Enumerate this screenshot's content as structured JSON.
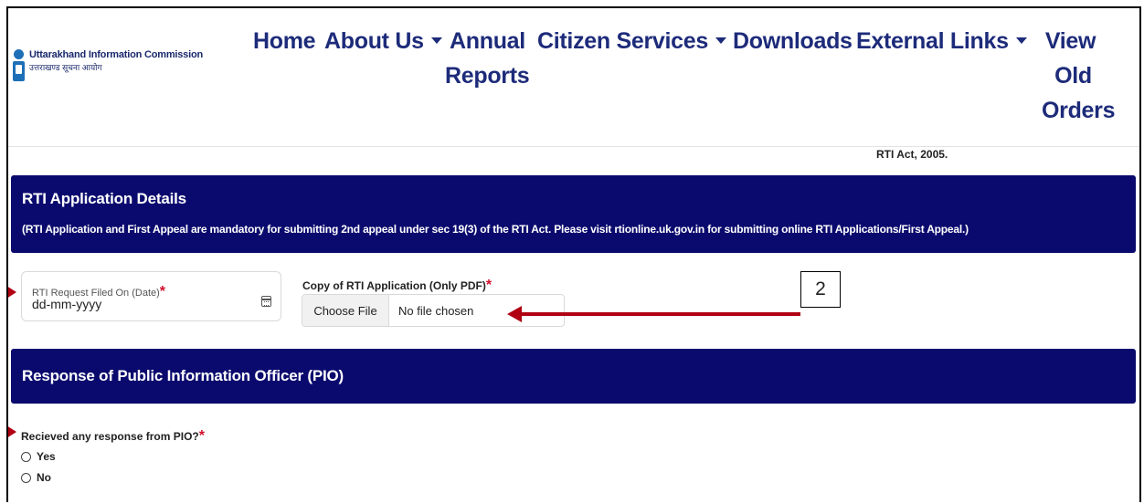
{
  "header": {
    "logo_title": "Uttarakhand Information Commission",
    "logo_subtitle": "उत्तराखण्ड सूचना आयोग",
    "nav": {
      "home": "Home",
      "about": "About Us",
      "annual_line1": "Annual",
      "annual_line2": "Reports",
      "citizen": "Citizen Services",
      "downloads": "Downloads",
      "external": "External Links",
      "view_line1": "View",
      "view_line2": "Old",
      "view_line3": "Orders"
    }
  },
  "act_text": "RTI Act, 2005.",
  "rti_section": {
    "title": "RTI Application Details",
    "note": "(RTI Application and First Appeal are mandatory for submitting 2nd appeal under sec 19(3) of the RTI Act. Please visit rtionline.uk.gov.in for submitting online RTI Applications/First Appeal.)"
  },
  "date_field": {
    "label": "RTI Request Filed On (Date)",
    "required_mark": "*",
    "value": "dd-mm-yyyy",
    "icon": "calendar-icon"
  },
  "file_field": {
    "label": "Copy of RTI Application (Only PDF)",
    "required_mark": "*",
    "button_label": "Choose File",
    "status": "No file chosen"
  },
  "annotation": {
    "number": "2",
    "color": "#b00012"
  },
  "pio_section": {
    "title": "Response of Public Information Officer (PIO)"
  },
  "pio_question": {
    "label": "Recieved any response from PIO?",
    "required_mark": "*",
    "options": [
      "Yes",
      "No"
    ]
  },
  "colors": {
    "panel_bg": "#0a0a6e",
    "nav_text": "#1d2b7a",
    "required": "#d0102b"
  }
}
